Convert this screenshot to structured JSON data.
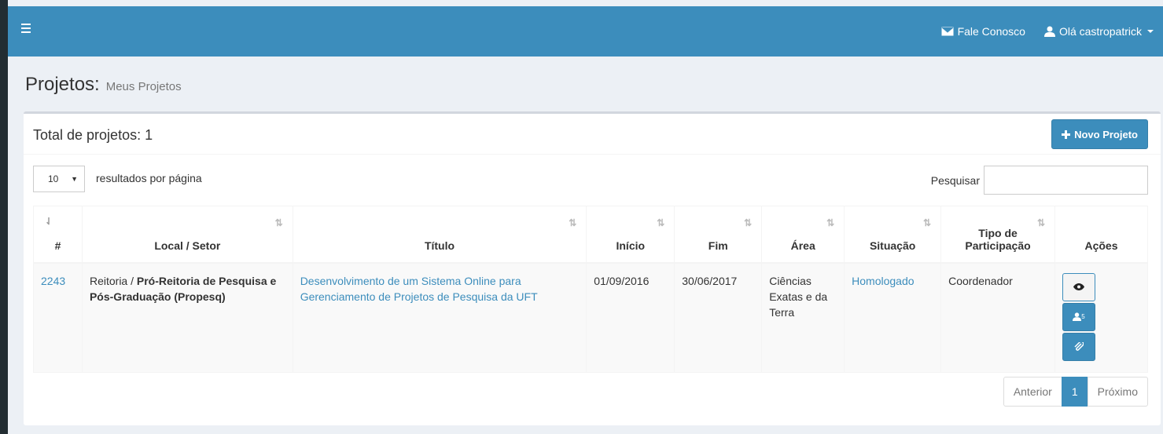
{
  "topbar": {
    "contact_label": "Fale Conosco",
    "user_label": "Olá castropatrick"
  },
  "header": {
    "title": "Projetos:",
    "subtitle": "Meus Projetos"
  },
  "box": {
    "title": "Total de projetos: 1",
    "new_button_label": "Novo Projeto"
  },
  "controls": {
    "page_length": "10",
    "page_length_label": "resultados por página",
    "search_label": "Pesquisar",
    "search_value": ""
  },
  "table": {
    "headers": [
      "#",
      "Local / Setor",
      "Título",
      "Início",
      "Fim",
      "Área",
      "Situação",
      "Tipo de Participação",
      "Ações"
    ],
    "rows": [
      {
        "id": "2243",
        "local_prefix": "Reitoria / ",
        "local_bold": "Pró-Reitoria de Pesquisa e Pós-Graduação (Propesq)",
        "titulo": "Desenvolvimento de um Sistema Online para Gerenciamento de Projetos de Pesquisa da UFT",
        "inicio": "01/09/2016",
        "fim": "30/06/2017",
        "area": "Ciências Exatas e da Terra",
        "situacao": "Homologado",
        "tipo": "Coordenador",
        "members_count": "5"
      }
    ]
  },
  "pagination": {
    "prev": "Anterior",
    "current": "1",
    "next": "Próximo"
  },
  "colors": {
    "primary": "#3c8dbc",
    "sidebar": "#222d32",
    "background": "#ecf0f5"
  }
}
